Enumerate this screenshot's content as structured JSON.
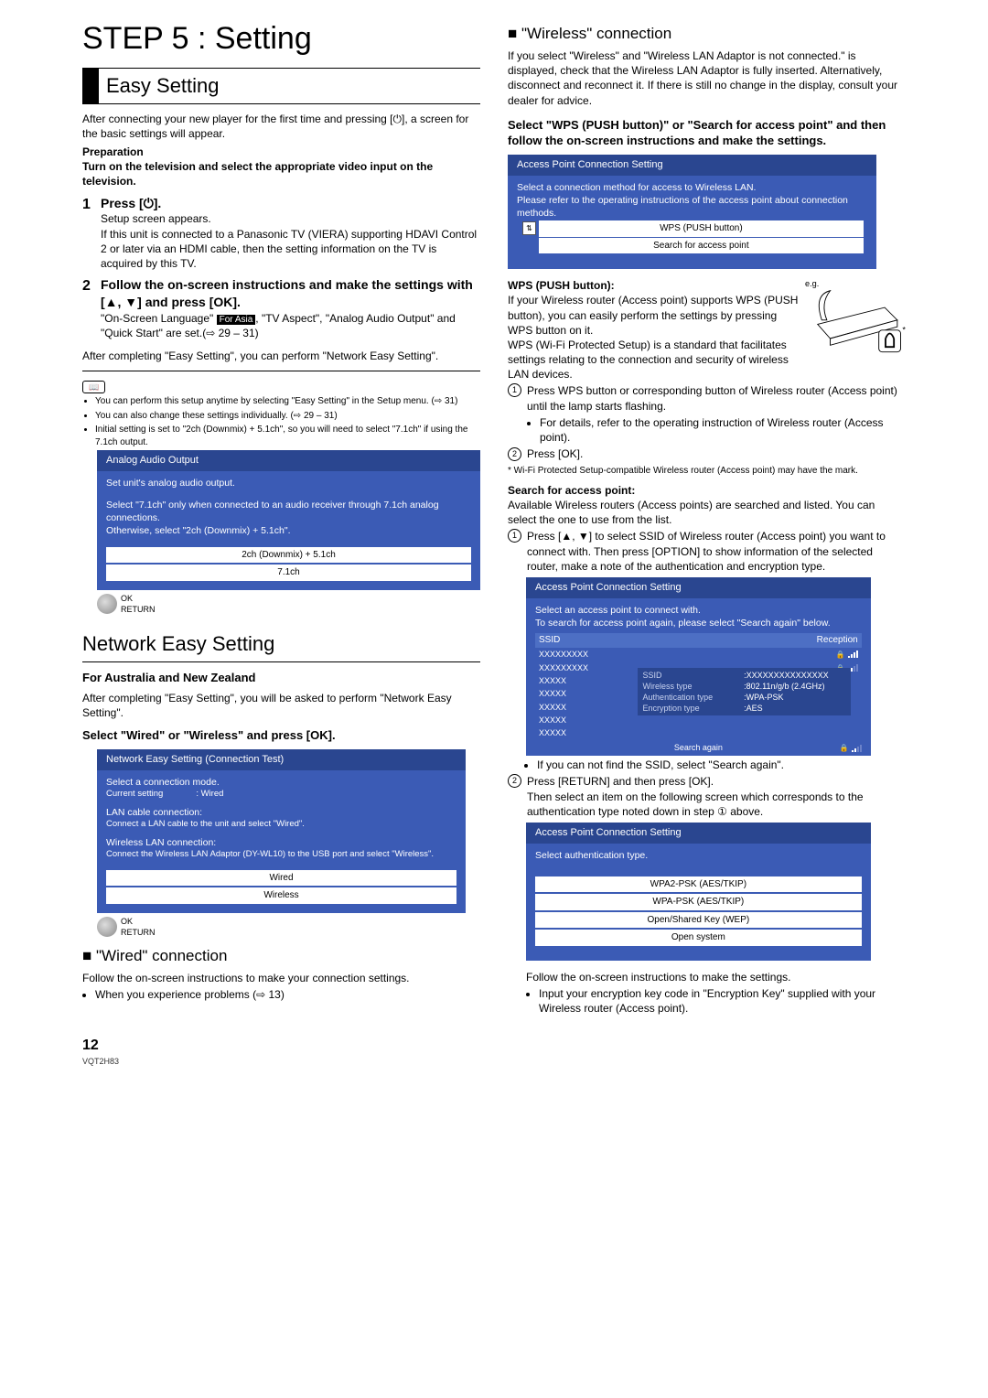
{
  "title": "STEP 5 : Setting",
  "easy": {
    "heading": "Easy Setting",
    "intro": "After connecting your new player for the first time and pressing [⏻], a screen for the basic settings will appear.",
    "prep_label": "Preparation",
    "prep_text": "Turn on the television and select the appropriate video input on the television.",
    "step1": {
      "title": "Press [⏻].",
      "l1": "Setup screen appears.",
      "l2": "If this unit is connected to a Panasonic TV (VIERA) supporting HDAVI Control 2 or later via an HDMI cable, then the setting information on the TV is acquired by this TV."
    },
    "step2": {
      "title": "Follow the on-screen instructions and make the settings with [▲, ▼] and press [OK].",
      "body_a": "\"On-Screen Language\" ",
      "body_badge": "For Asia",
      "body_b": ", \"TV Aspect\", \"Analog Audio Output\" and \"Quick Start\" are set.(⇨ 29 – 31)"
    },
    "after": "After completing \"Easy Setting\", you can perform \"Network Easy Setting\".",
    "notes": [
      "You can perform this setup anytime by selecting \"Easy Setting\" in the Setup menu. (⇨ 31)",
      "You can also change these settings individually. (⇨ 29 – 31)",
      "Initial setting is set to \"2ch (Downmix) + 5.1ch\", so you will need to select \"7.1ch\" if using the 7.1ch output."
    ],
    "audiobox": {
      "title": "Analog Audio Output",
      "sub": "Set unit's analog audio output.",
      "info": "Select \"7.1ch\" only when connected to an audio receiver through 7.1ch analog connections.\nOtherwise, select \"2ch (Downmix) + 5.1ch\".",
      "opt1": "2ch (Downmix) + 5.1ch",
      "opt2": "7.1ch"
    },
    "okret": {
      "ok": "OK",
      "ret": "RETURN"
    }
  },
  "net": {
    "heading": "Network Easy Setting",
    "region": "For Australia and New Zealand",
    "intro": "After completing \"Easy Setting\", you will be asked to perform \"Network Easy Setting\".",
    "select": "Select \"Wired\" or \"Wireless\" and press [OK].",
    "box": {
      "title": "Network Easy Setting (Connection Test)",
      "mode_label": "Select a connection mode.",
      "current_k": "Current setting",
      "current_v": ": Wired",
      "lan_lbl": "LAN cable connection:",
      "lan_txt": "Connect a LAN cable to the unit and select \"Wired\".",
      "wlan_lbl": "Wireless LAN connection:",
      "wlan_txt": "Connect the Wireless LAN Adaptor (DY-WL10) to the USB port and select \"Wireless\".",
      "opt1": "Wired",
      "opt2": "Wireless"
    },
    "wired_hdr": "\"Wired\" connection",
    "wired_l1": "Follow the on-screen instructions to make your connection settings.",
    "wired_l2": "When you experience problems (⇨ 13)"
  },
  "wless": {
    "hdr": "\"Wireless\" connection",
    "intro": "If you select \"Wireless\" and \"Wireless LAN Adaptor is not connected.\" is displayed, check that the Wireless LAN Adaptor is fully inserted. Alternatively, disconnect and reconnect it. If there is still no change in the display, consult your dealer for advice.",
    "select": "Select \"WPS (PUSH button)\" or \"Search for access point\" and then follow the on-screen instructions and make the settings.",
    "apbox": {
      "title": "Access Point Connection Setting",
      "info": "Select a connection method for access to Wireless LAN.\nPlease refer to the operating instructions of the access point about connection methods.",
      "opt1": "WPS (PUSH button)",
      "opt2": "Search for access point"
    },
    "eg": "e.g.",
    "wps_lbl": "WPS (PUSH button):",
    "wps_p1": "If your Wireless router (Access point) supports WPS (PUSH button), you can easily perform the settings by pressing WPS button on it.",
    "wps_p2": "WPS (Wi-Fi Protected Setup) is a standard that facilitates settings relating to the connection and security of wireless LAN devices.",
    "wps_s1": "Press WPS button or corresponding button of Wireless router (Access point) until the lamp starts flashing.",
    "wps_s1b": "For details, refer to the operating instruction of Wireless router (Access point).",
    "wps_s2": "Press [OK].",
    "wps_foot": "* Wi-Fi Protected Setup-compatible Wireless router (Access point) may have the mark.",
    "search_lbl": "Search for access point:",
    "search_p": "Available Wireless routers (Access points) are searched and listed. You can select the one to use from the list.",
    "search_s1": "Press [▲, ▼] to select SSID of Wireless router (Access point) you want to connect with. Then press [OPTION] to show information of the selected router, make a note of the authentication and encryption type.",
    "ssidbox": {
      "title": "Access Point Connection Setting",
      "info": "Select an access point to connect with.\nTo search for access point again, please select \"Search again\" below.",
      "col1": "SSID",
      "col2": "Reception",
      "rows": [
        "XXXXXXXXX",
        "XXXXXXXXX",
        "XXXXX",
        "XXXXX",
        "XXXXX",
        "XXXXX",
        "XXXXX",
        "XXXXX"
      ],
      "details": {
        "ssid_k": "SSID",
        "ssid_v": ":XXXXXXXXXXXXXXX",
        "wt_k": "Wireless type",
        "wt_v": ":802.11n/g/b (2.4GHz)",
        "at_k": "Authentication type",
        "at_v": ":WPA-PSK",
        "et_k": "Encryption type",
        "et_v": ":AES"
      },
      "again": "Search again"
    },
    "search_b1": "If you can not find the SSID, select \"Search again\".",
    "search_s2a": "Press [RETURN] and then press [OK].",
    "search_s2b": "Then select an item on the following screen which corresponds to the authentication type noted down in step ① above.",
    "authbox": {
      "title": "Access Point Connection Setting",
      "info": "Select authentication type.",
      "opts": [
        "WPA2-PSK (AES/TKIP)",
        "WPA-PSK (AES/TKIP)",
        "Open/Shared Key (WEP)",
        "Open system"
      ]
    },
    "foot1": "Follow the on-screen instructions to make the settings.",
    "foot2": "Input your encryption key code in \"Encryption Key\" supplied with your Wireless router (Access point)."
  },
  "footer": {
    "page": "12",
    "doc": "VQT2H83"
  }
}
